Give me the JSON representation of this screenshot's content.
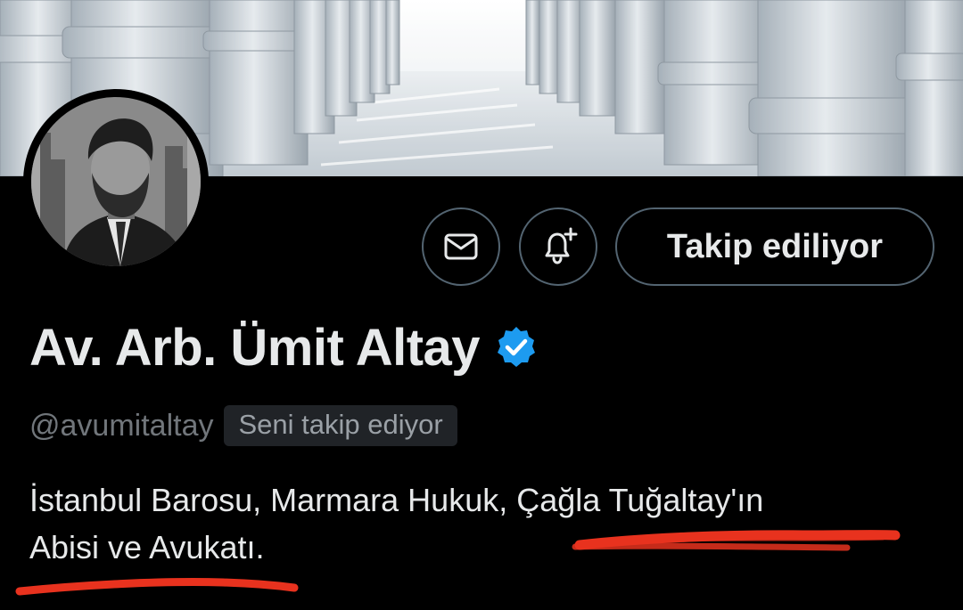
{
  "profile": {
    "display_name": "Av. Arb. Ümit Altay",
    "handle": "@avumitaltay",
    "follows_you_badge": "Seni takip ediyor",
    "bio_line_1": "İstanbul Barosu, Marmara Hukuk, Çağla Tuğaltay'ın",
    "bio_line_2": "Abisi ve Avukatı.",
    "verified": true
  },
  "actions": {
    "message_icon": "mail-icon",
    "notify_icon": "bell-plus-icon",
    "follow_label": "Takip ediliyor"
  },
  "colors": {
    "background": "#000000",
    "text_primary": "#e7e9ea",
    "text_secondary": "#71767b",
    "verified_badge": "#1d9bf0",
    "badge_background": "#202327",
    "annotation_underline": "#e8321e"
  }
}
